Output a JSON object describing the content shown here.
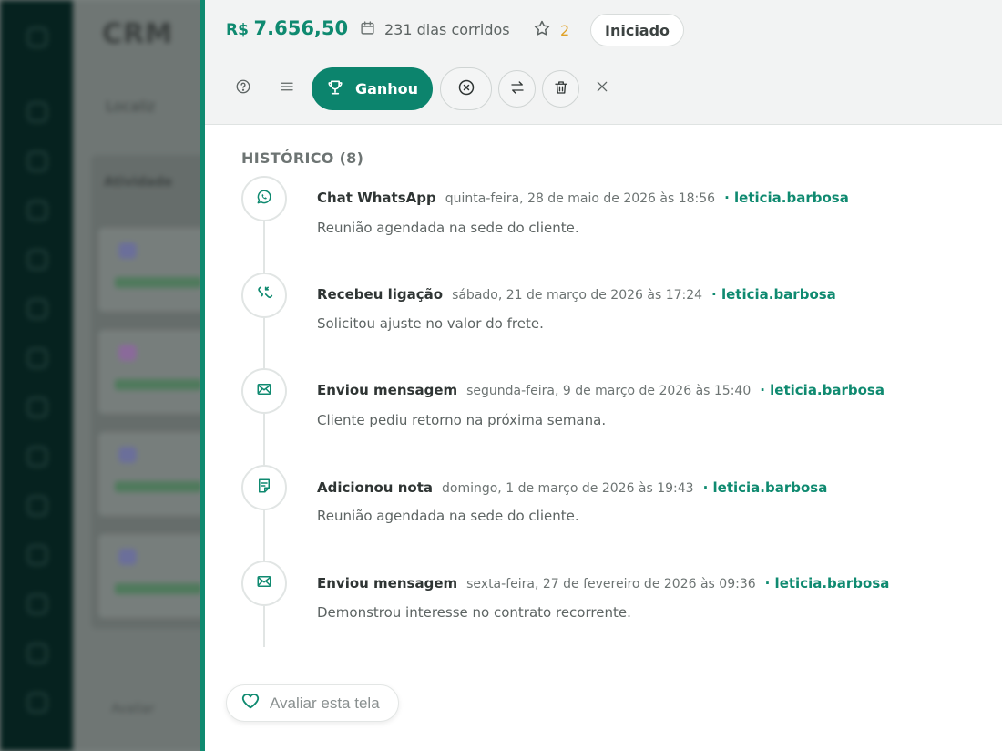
{
  "background": {
    "app_title": "CRM",
    "filter_label": "Localiz",
    "column_title": "Atividade",
    "footer_text": "Avaliar"
  },
  "header": {
    "currency": "R$",
    "amount": "7.656,50",
    "days": "231 dias corridos",
    "rating": "2",
    "status": "Iniciado"
  },
  "toolbar": {
    "won_label": "Ganhou"
  },
  "history": {
    "title": "HISTÓRICO (8)",
    "entries": [
      {
        "icon": "whatsapp-icon",
        "type": "Chat WhatsApp",
        "date": "quinta-feira, 28 de maio de 2026 às 18:56",
        "user": "· leticia.barbosa",
        "description": "Reunião agendada na sede do cliente."
      },
      {
        "icon": "phone-incoming-icon",
        "type": "Recebeu ligação",
        "date": "sábado, 21 de março de 2026 às 17:24",
        "user": "· leticia.barbosa",
        "description": "Solicitou ajuste no valor do frete."
      },
      {
        "icon": "mail-icon",
        "type": "Enviou mensagem",
        "date": "segunda-feira, 9 de março de 2026 às 15:40",
        "user": "· leticia.barbosa",
        "description": "Cliente pediu retorno na próxima semana."
      },
      {
        "icon": "note-icon",
        "type": "Adicionou nota",
        "date": "domingo, 1 de março de 2026 às 19:43",
        "user": "· leticia.barbosa",
        "description": "Reunião agendada na sede do cliente."
      },
      {
        "icon": "mail-icon",
        "type": "Enviou mensagem",
        "date": "sexta-feira, 27 de fevereiro de 2026 às 09:36",
        "user": "· leticia.barbosa",
        "description": "Demonstrou interesse no contrato recorrente."
      }
    ]
  },
  "feedback": {
    "label": "Avaliar esta tela"
  },
  "colors": {
    "accent": "#0f8a70",
    "star": "#e0a126",
    "rail": "#06221f"
  }
}
